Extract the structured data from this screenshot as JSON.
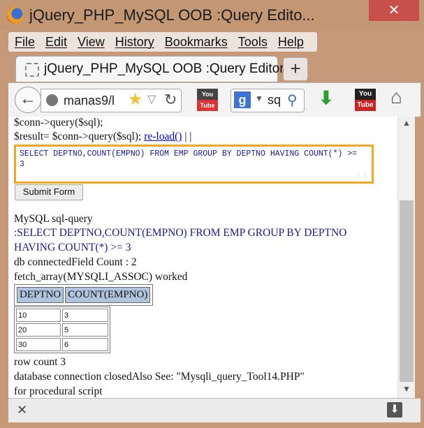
{
  "window": {
    "title": "jQuery_PHP_MySQL OOB :Query Edito...",
    "minimize": "–",
    "maximize": "☐",
    "close": "✕"
  },
  "menu": [
    "File",
    "Edit",
    "View",
    "History",
    "Bookmarks",
    "Tools",
    "Help"
  ],
  "tab": {
    "title": "jQuery_PHP_MySQL OOB :Query Editor",
    "new_tab": "+"
  },
  "navbar": {
    "url": "manas9/l",
    "search_text": "sq",
    "search_engine": "g"
  },
  "page": {
    "line1": "$conn->query($sql);",
    "line2_prefix": "$result= $conn->query($sql); ",
    "line2_link": "re-load()",
    "line2_suffix": " | |",
    "sql_text": "SELECT DEPTNO,COUNT(EMPNO) FROM EMP GROUP BY DEPTNO HAVING COUNT(*) >= 3",
    "submit_label": "Submit Form",
    "mysql_label": "MySQL sql-query",
    "query_line1": ":SELECT DEPTNO,COUNT(EMPNO) FROM EMP GROUP BY DEPTNO",
    "query_line2": "HAVING COUNT(*) >= 3",
    "field_count": "db connectedField Count : 2",
    "fetch_label": "fetch_array(MYSQLI_ASSOC) worked",
    "table_headers": [
      "DEPTNO",
      "COUNT(EMPNO)"
    ],
    "rows": [
      [
        "10",
        "3"
      ],
      [
        "20",
        "5"
      ],
      [
        "30",
        "6"
      ]
    ],
    "row_count": "row count 3",
    "closed_line": "database connection closedAlso See: \"Mysqli_query_Tool14.PHP\"",
    "procedural": "for procedural script"
  },
  "icons": [
    "firefox-logo",
    "back-arrow-icon",
    "globe-icon",
    "star-icon",
    "reload-icon",
    "youtube-icon",
    "google-icon",
    "search-icon",
    "download-arrow-icon",
    "home-icon",
    "close-icon",
    "download-box-icon"
  ]
}
